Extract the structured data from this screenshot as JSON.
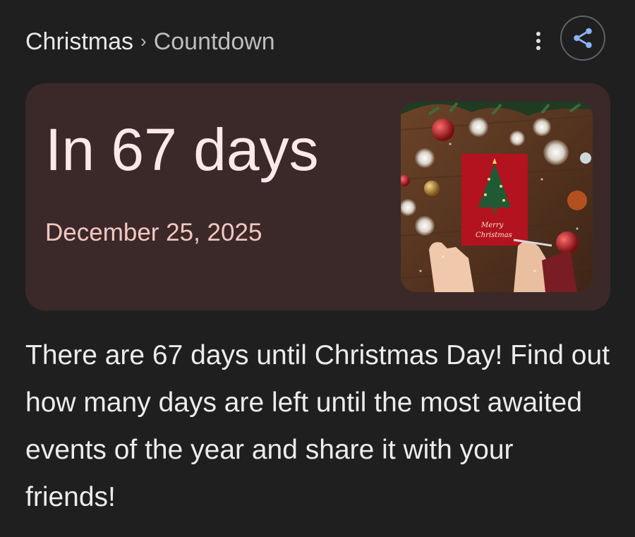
{
  "header": {
    "breadcrumb_1": "Christmas",
    "separator": "›",
    "breadcrumb_2": "Countdown",
    "more_icon": "more-vert-icon",
    "share_icon": "share-icon"
  },
  "card": {
    "title": "In 67 days",
    "date": "December 25, 2025",
    "card_background": "#3b2929",
    "title_color": "#fbe9e7",
    "date_color": "#f3c7c2"
  },
  "description": "There are 67 days until Christmas Day! Find out how many days are left until the most awaited events of the year and share it with your friends!",
  "colors": {
    "page_background": "#1f1f1f",
    "share_accent": "#8ab4f8"
  }
}
